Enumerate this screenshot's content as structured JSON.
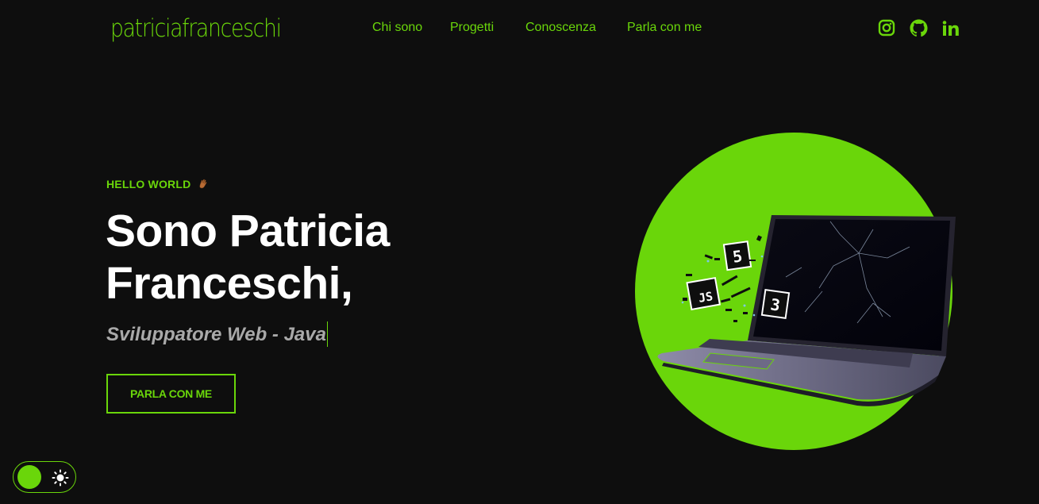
{
  "brand": {
    "logo_text": "patriciafranceschi"
  },
  "nav": {
    "items": [
      "Chi sono",
      "Progetti",
      "Conoscenza",
      "Parla con me"
    ]
  },
  "social": {
    "icons": [
      "instagram-icon",
      "github-icon",
      "linkedin-icon"
    ]
  },
  "hero": {
    "greeting": "HELLO WORLD",
    "greeting_emoji": "waving-hand-icon",
    "headline_line1": "Sono Patricia",
    "headline_line2": "Franceschi,",
    "role_text": "Sviluppatore Web - Java",
    "cta_label": "PARLA CON ME",
    "image_badges": [
      "5",
      "JS",
      "3"
    ]
  },
  "theme_toggle": {
    "icon": "sun-icon",
    "state": "dark"
  },
  "colors": {
    "accent": "#6ad60a",
    "background": "#0e0e0e",
    "text": "#ffffff",
    "muted": "#a9a9a9"
  }
}
